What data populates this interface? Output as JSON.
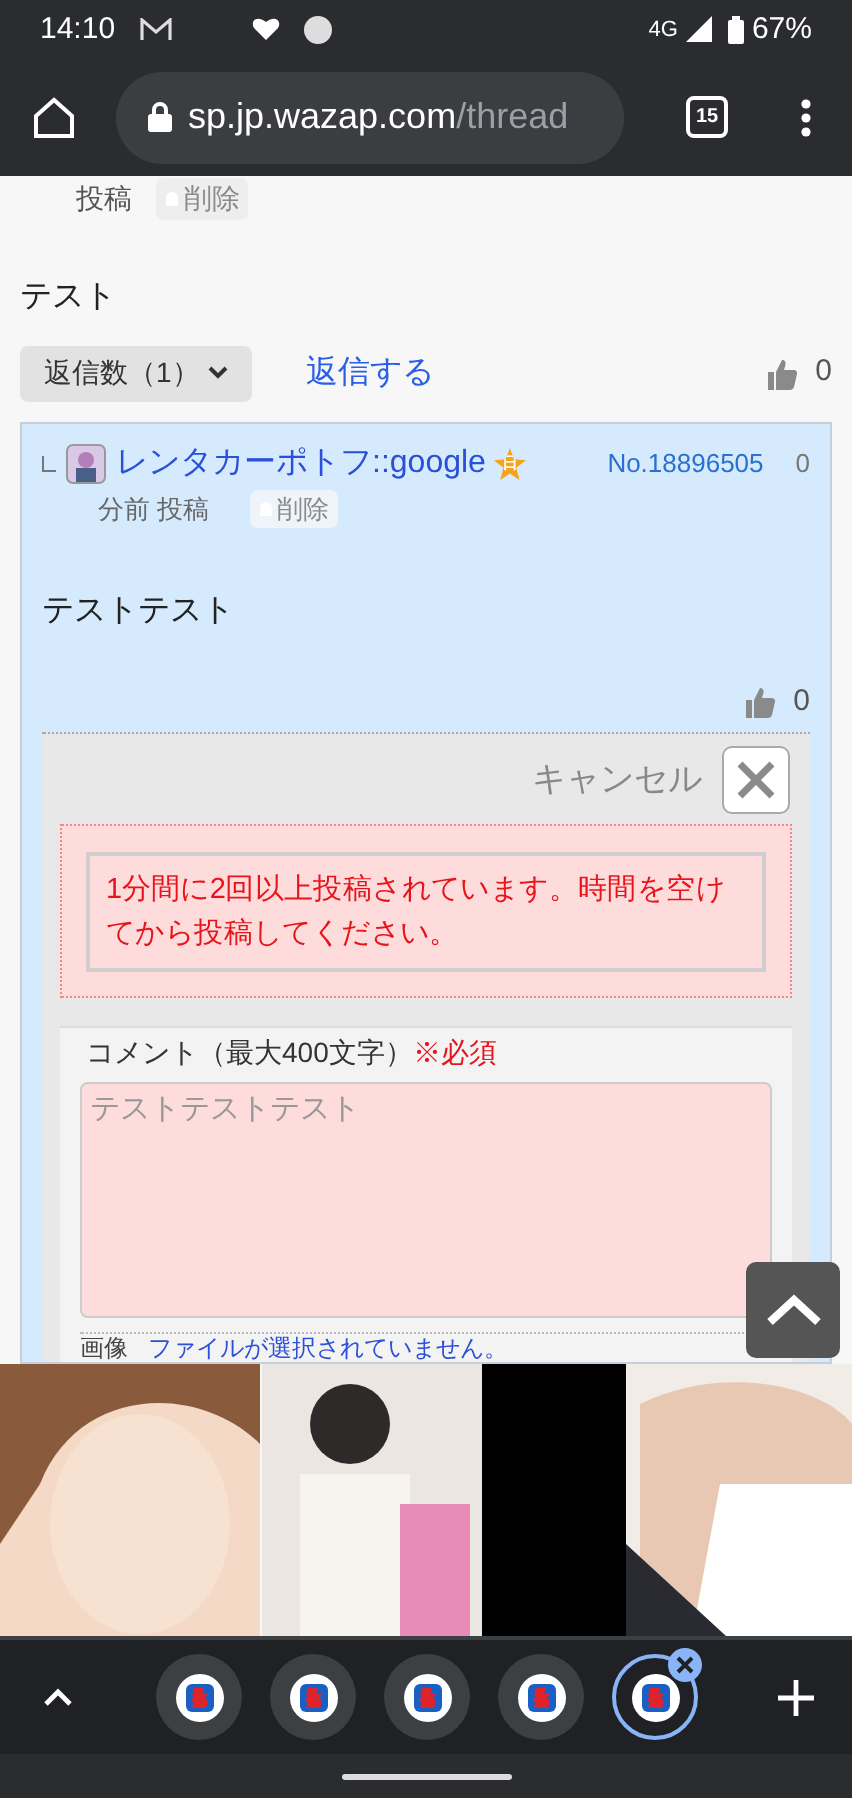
{
  "status_bar": {
    "time": "14:10",
    "network": "4G",
    "battery": "67%"
  },
  "browser": {
    "url_host": "sp.jp.wazap.com",
    "url_path": "/thread",
    "tab_count": "15"
  },
  "top_post": {
    "action": "投稿",
    "delete": "削除",
    "body": "テスト",
    "reply_count": "返信数（1）",
    "reply_link": "返信する",
    "likes": "0"
  },
  "reply": {
    "author": "レンタカーポトフ::google",
    "badge": "日",
    "number": "No.18896505",
    "count": "0",
    "time": "分前 投稿",
    "delete": "削除",
    "body": "テストテスト",
    "likes": "0"
  },
  "form": {
    "cancel": "キャンセル",
    "error": "1分間に2回以上投稿されています。時間を空けてから投稿してください。",
    "comment_label": "コメント（最大400文字）",
    "required": "※必須",
    "comment_placeholder": "テストテストテスト",
    "image_label": "画像",
    "file_status": "ファイルが選択されていません。"
  },
  "tabs": [
    {
      "selected": false
    },
    {
      "selected": false
    },
    {
      "selected": false
    },
    {
      "selected": false
    },
    {
      "selected": true
    }
  ]
}
